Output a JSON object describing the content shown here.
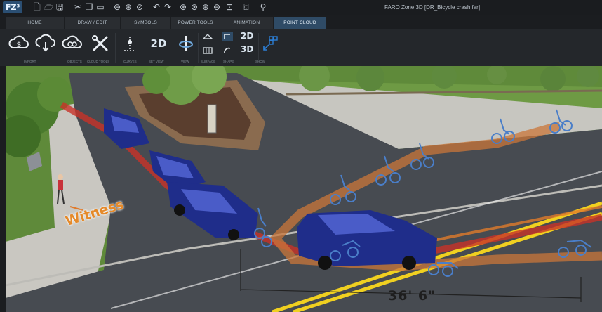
{
  "app": {
    "logo": "FZ³",
    "window_title": "FARO Zone 3D [DR_Bicycle crash.far]"
  },
  "quick_access": [
    {
      "name": "new-file-icon",
      "glyph": "🗋"
    },
    {
      "name": "open-file-icon",
      "glyph": "🗁"
    },
    {
      "name": "save-icon",
      "glyph": "🖫"
    },
    {
      "name": "cut-icon",
      "glyph": "✂"
    },
    {
      "name": "copy-icon",
      "glyph": "❐"
    },
    {
      "name": "paste-icon",
      "glyph": "▭"
    },
    {
      "name": "vehicle-front-icon",
      "glyph": "⊖"
    },
    {
      "name": "vehicle-side-icon",
      "glyph": "⊕"
    },
    {
      "name": "scene-icon",
      "glyph": "⊘"
    },
    {
      "name": "undo-icon",
      "glyph": "↶"
    },
    {
      "name": "redo-icon",
      "glyph": "↷"
    },
    {
      "name": "select-icon",
      "glyph": "⊛"
    },
    {
      "name": "deselect-icon",
      "glyph": "⊗"
    },
    {
      "name": "zoom-in-icon",
      "glyph": "⊕"
    },
    {
      "name": "zoom-out-icon",
      "glyph": "⊖"
    },
    {
      "name": "export-icon",
      "glyph": "⊡"
    },
    {
      "name": "camera-icon",
      "glyph": "⌼"
    },
    {
      "name": "help-icon",
      "glyph": "⚲"
    }
  ],
  "tabs": [
    {
      "label": "HOME",
      "active": false
    },
    {
      "label": "DRAW / EDIT",
      "active": false
    },
    {
      "label": "SYMBOLS",
      "active": false
    },
    {
      "label": "POWER TOOLS",
      "active": false
    },
    {
      "label": "ANIMATION",
      "active": false
    },
    {
      "label": "POINT CLOUD",
      "active": true
    }
  ],
  "ribbon": {
    "text_buttons": {
      "view_2d_large": "2D",
      "view_2d_small": "2D",
      "view_3d_small": "3D"
    },
    "group_labels": {
      "import": "IMPORT",
      "objects": "OBJECTS",
      "cloud_tools": "CLOUD TOOLS",
      "curves": "CURVES",
      "set_view": "SET VIEW",
      "view": "VIEW",
      "surface": "SURFACE",
      "shape": "SHAPE",
      "show": "SHOW"
    }
  },
  "viewport": {
    "witness_label": "Witness",
    "measurement_label": "36' 6\""
  },
  "colors": {
    "accent": "#2f4b66",
    "ribbon_bg": "#24272b",
    "icon_blue": "#2c7fd6",
    "vehicle": "#1f2d8a",
    "path_red": "#c83228",
    "path_orange": "#e07a2a"
  }
}
